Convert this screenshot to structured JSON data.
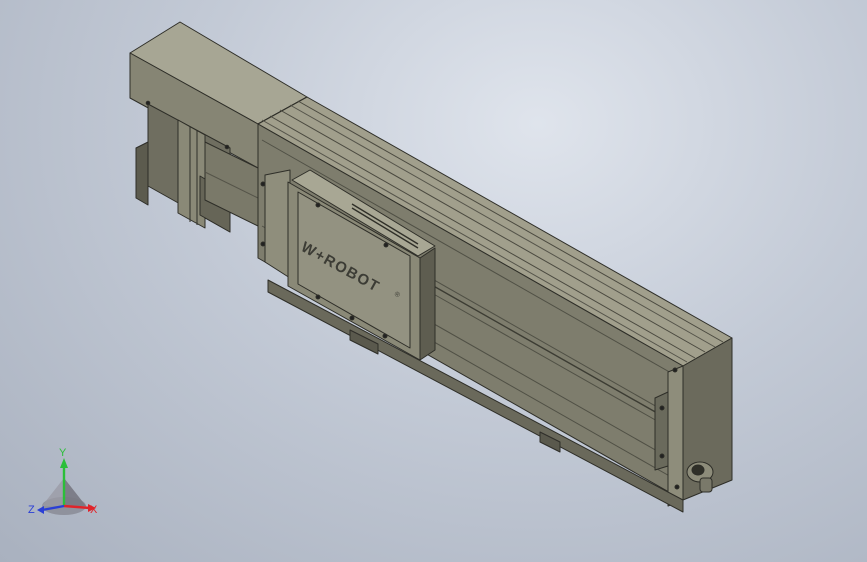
{
  "model": {
    "brand_logo_text": "W+ROBOT",
    "brand_logo_mark": "®"
  },
  "triad": {
    "x_label": "X",
    "y_label": "Y",
    "z_label": "Z",
    "x_color": "#e0242a",
    "y_color": "#2bbf39",
    "z_color": "#2a3fd6"
  },
  "colors": {
    "body": "#7e7d6d",
    "body_light": "#9b9a88",
    "body_dark": "#5e5d50",
    "outline": "#2e2e28"
  }
}
